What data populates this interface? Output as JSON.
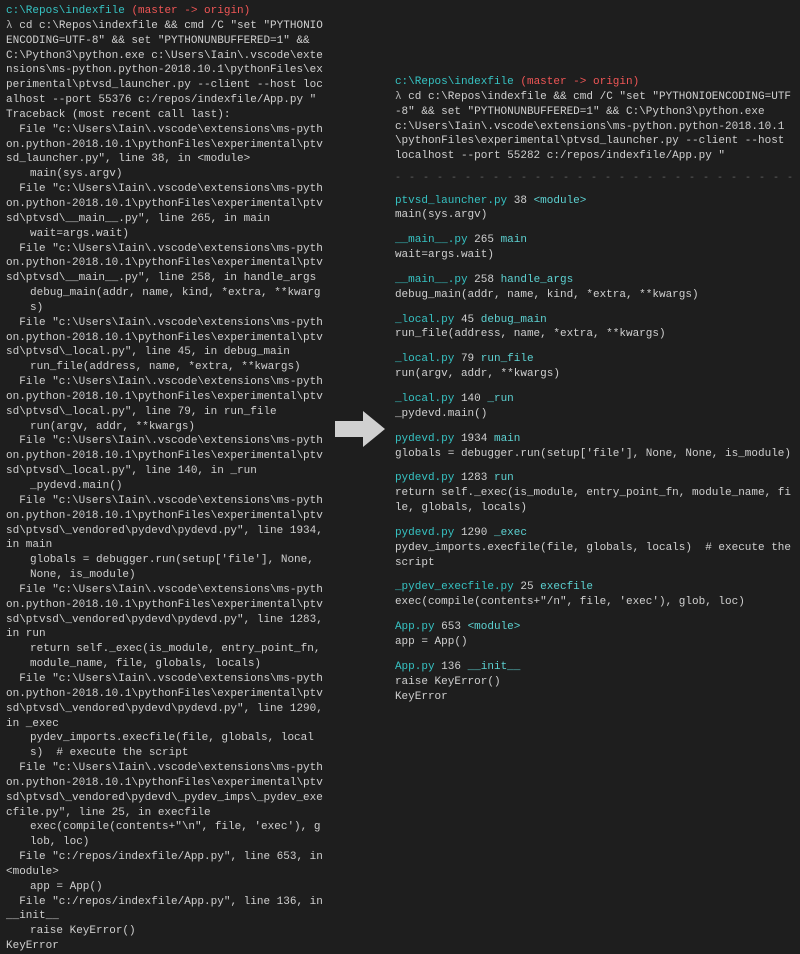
{
  "prompt": {
    "path": "c:\\Repos\\indexfile",
    "branch": "(master -> origin)",
    "lambda": "λ"
  },
  "left": {
    "command": "cd c:\\Repos\\indexfile && cmd /C \"set \"PYTHONIOENCODING=UTF-8\" && set \"PYTHONUNBUFFERED=1\" && C:\\Python3\\python.exe c:\\Users\\Iain\\.vscode\\extensions\\ms-python.python-2018.10.1\\pythonFiles\\experimental\\ptvsd_launcher.py --client --host localhost --port 55376 c:/repos/indexfile/App.py \"",
    "traceback_header": "Traceback (most recent call last):",
    "frames": [
      {
        "file": "  File \"c:\\Users\\Iain\\.vscode\\extensions\\ms-python.python-2018.10.1\\pythonFiles\\experimental\\ptvsd_launcher.py\", line 38, in <module>",
        "code": "main(sys.argv)"
      },
      {
        "file": "  File \"c:\\Users\\Iain\\.vscode\\extensions\\ms-python.python-2018.10.1\\pythonFiles\\experimental\\ptvsd\\ptvsd\\__main__.py\", line 265, in main",
        "code": "wait=args.wait)"
      },
      {
        "file": "  File \"c:\\Users\\Iain\\.vscode\\extensions\\ms-python.python-2018.10.1\\pythonFiles\\experimental\\ptvsd\\ptvsd\\__main__.py\", line 258, in handle_args",
        "code": "debug_main(addr, name, kind, *extra, **kwargs)"
      },
      {
        "file": "  File \"c:\\Users\\Iain\\.vscode\\extensions\\ms-python.python-2018.10.1\\pythonFiles\\experimental\\ptvsd\\ptvsd\\_local.py\", line 45, in debug_main",
        "code": "run_file(address, name, *extra, **kwargs)"
      },
      {
        "file": "  File \"c:\\Users\\Iain\\.vscode\\extensions\\ms-python.python-2018.10.1\\pythonFiles\\experimental\\ptvsd\\ptvsd\\_local.py\", line 79, in run_file",
        "code": "run(argv, addr, **kwargs)"
      },
      {
        "file": "  File \"c:\\Users\\Iain\\.vscode\\extensions\\ms-python.python-2018.10.1\\pythonFiles\\experimental\\ptvsd\\ptvsd\\_local.py\", line 140, in _run",
        "code": "_pydevd.main()"
      },
      {
        "file": "  File \"c:\\Users\\Iain\\.vscode\\extensions\\ms-python.python-2018.10.1\\pythonFiles\\experimental\\ptvsd\\ptvsd\\_vendored\\pydevd\\pydevd.py\", line 1934, in main",
        "code": "globals = debugger.run(setup['file'], None, None, is_module)"
      },
      {
        "file": "  File \"c:\\Users\\Iain\\.vscode\\extensions\\ms-python.python-2018.10.1\\pythonFiles\\experimental\\ptvsd\\ptvsd\\_vendored\\pydevd\\pydevd.py\", line 1283, in run",
        "code": "return self._exec(is_module, entry_point_fn, module_name, file, globals, locals)"
      },
      {
        "file": "  File \"c:\\Users\\Iain\\.vscode\\extensions\\ms-python.python-2018.10.1\\pythonFiles\\experimental\\ptvsd\\ptvsd\\_vendored\\pydevd\\pydevd.py\", line 1290, in _exec",
        "code": "pydev_imports.execfile(file, globals, locals)  # execute the script"
      },
      {
        "file": "  File \"c:\\Users\\Iain\\.vscode\\extensions\\ms-python.python-2018.10.1\\pythonFiles\\experimental\\ptvsd\\ptvsd\\_vendored\\pydevd\\_pydev_imps\\_pydev_execfile.py\", line 25, in execfile",
        "code": "exec(compile(contents+\"\\n\", file, 'exec'), glob, loc)"
      },
      {
        "file": "  File \"c:/repos/indexfile/App.py\", line 653, in <module>",
        "code": "app = App()"
      },
      {
        "file": "  File \"c:/repos/indexfile/App.py\", line 136, in __init__",
        "code": "raise KeyError()"
      }
    ],
    "error": "KeyError"
  },
  "right": {
    "command": "cd c:\\Repos\\indexfile && cmd /C \"set \"PYTHONIOENCODING=UTF-8\" && set \"PYTHONUNBUFFERED=1\" && C:\\Python3\\python.exe c:\\Users\\Iain\\.vscode\\extensions\\ms-python.python-2018.10.1\\pythonFiles\\experimental\\ptvsd_launcher.py --client --host localhost --port 55282 c:/repos/indexfile/App.py \"",
    "separator": "- - - - - - - - - - - - - - - - - - - - - - - - - - - - -",
    "entries": [
      {
        "file": "ptvsd_launcher.py",
        "line": "38",
        "fn": "<module>",
        "code": "main(sys.argv)"
      },
      {
        "file": "__main__.py",
        "line": "265",
        "fn": "main",
        "code": "wait=args.wait)"
      },
      {
        "file": "__main__.py",
        "line": "258",
        "fn": "handle_args",
        "code": "debug_main(addr, name, kind, *extra, **kwargs)"
      },
      {
        "file": "_local.py",
        "line": "45",
        "fn": "debug_main",
        "code": "run_file(address, name, *extra, **kwargs)"
      },
      {
        "file": "_local.py",
        "line": "79",
        "fn": "run_file",
        "code": "run(argv, addr, **kwargs)"
      },
      {
        "file": "_local.py",
        "line": "140",
        "fn": "_run",
        "code": "_pydevd.main()"
      },
      {
        "file": "pydevd.py",
        "line": "1934",
        "fn": "main",
        "code": "globals = debugger.run(setup['file'], None, None, is_module)"
      },
      {
        "file": "pydevd.py",
        "line": "1283",
        "fn": "run",
        "code": "return self._exec(is_module, entry_point_fn, module_name, file, globals, locals)"
      },
      {
        "file": "pydevd.py",
        "line": "1290",
        "fn": "_exec",
        "code": "pydev_imports.execfile(file, globals, locals)  # execute the script"
      },
      {
        "file": "_pydev_execfile.py",
        "line": "25",
        "fn": "execfile",
        "code": "exec(compile(contents+\"/n\", file, 'exec'), glob, loc)"
      },
      {
        "file": "App.py",
        "line": "653",
        "fn": "<module>",
        "code": "app = App()"
      },
      {
        "file": "App.py",
        "line": "136",
        "fn": "__init__",
        "code": "raise KeyError()\nKeyError"
      }
    ]
  }
}
